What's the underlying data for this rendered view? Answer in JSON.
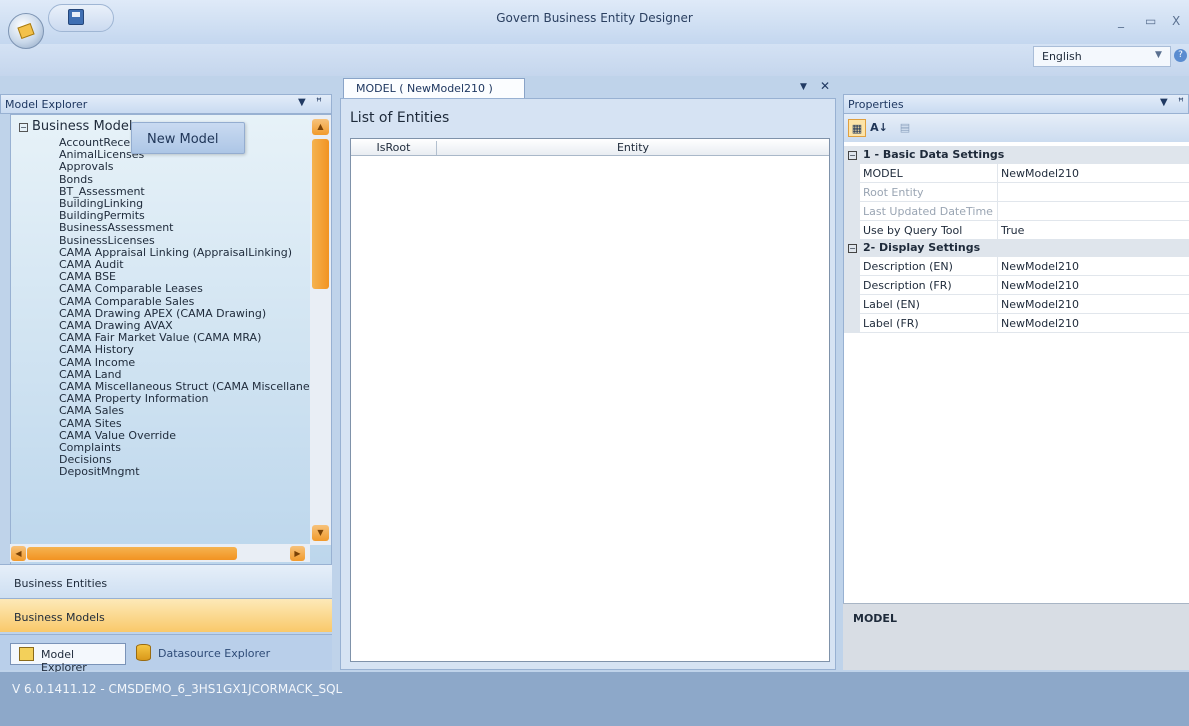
{
  "window": {
    "title": "Govern Business Entity Designer",
    "minimize": "_",
    "maximize": "▭",
    "close": "X"
  },
  "language": {
    "selected": "English"
  },
  "model_explorer": {
    "header": "Model Explorer",
    "root": "Business Models",
    "items": [
      "AccountReceivables",
      "AnimalLicenses",
      "Approvals",
      "Bonds",
      "BT_Assessment",
      "BuildingLinking",
      "BuildingPermits",
      "BusinessAssessment",
      "BusinessLicenses",
      "CAMA Appraisal Linking (AppraisalLinking)",
      "CAMA Audit",
      "CAMA BSE",
      "CAMA Comparable Leases",
      "CAMA Comparable Sales",
      "CAMA Drawing APEX (CAMA Drawing)",
      "CAMA Drawing AVAX",
      "CAMA Fair Market Value (CAMA MRA)",
      "CAMA History",
      "CAMA Income",
      "CAMA Land",
      "CAMA Miscellaneous Struct (CAMA Miscellaneous)",
      "CAMA Property Information",
      "CAMA Sales",
      "CAMA Sites",
      "CAMA Value Override",
      "Complaints",
      "Decisions",
      "DepositMngmt"
    ],
    "context_menu": {
      "new_model": "New Model"
    },
    "nav": {
      "business_entities": "Business Entities",
      "business_models": "Business Models"
    },
    "tabs": {
      "model_explorer": "Model Explorer",
      "datasource_explorer": "Datasource Explorer"
    }
  },
  "document": {
    "tab_label": "MODEL ( NewModel210 )",
    "list_title": "List of Entities",
    "columns": {
      "isroot": "IsRoot",
      "entity": "Entity"
    },
    "rows": []
  },
  "properties": {
    "header": "Properties",
    "sections": [
      {
        "title": "1 - Basic Data Settings"
      },
      {
        "title": "2- Display Settings"
      }
    ],
    "rows": [
      {
        "name": "MODEL",
        "value": "NewModel210"
      },
      {
        "name": "Root Entity",
        "value": ""
      },
      {
        "name": "Last Updated DateTime",
        "value": ""
      },
      {
        "name": "Use by Query Tool",
        "value": "True"
      },
      {
        "name": "Description (EN)",
        "value": "NewModel210"
      },
      {
        "name": "Description (FR)",
        "value": "NewModel210"
      },
      {
        "name": "Label (EN)",
        "value": "NewModel210"
      },
      {
        "name": "Label (FR)",
        "value": "NewModel210"
      }
    ],
    "description_title": "MODEL"
  },
  "status": {
    "text": "V 6.0.1411.12 - CMSDEMO_6_3HS1GX1JCORMACK_SQL"
  },
  "colors": {
    "accent_orange": "#f29322",
    "panel_blue": "#bfd3ea",
    "status_bar": "#8da8c9"
  }
}
